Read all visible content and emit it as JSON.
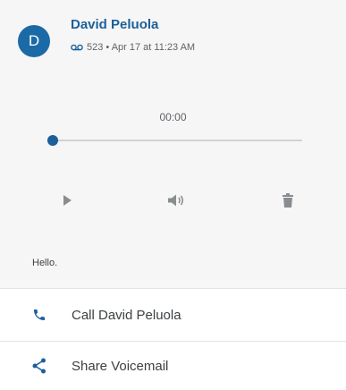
{
  "voicemail": {
    "avatar_letter": "D",
    "caller_name": "David Peluola",
    "meta": "523 • Apr 17 at 11:23 AM",
    "elapsed": "00:00",
    "progress": 0,
    "transcript": "Hello."
  },
  "controls": {
    "play_icon": "play-icon",
    "speaker_icon": "speaker-icon",
    "delete_icon": "trash-icon"
  },
  "actions": [
    {
      "label": "Call David Peluola",
      "icon": "phone-icon"
    },
    {
      "label": "Share Voicemail",
      "icon": "share-icon"
    }
  ],
  "colors": {
    "accent": "#1c5f9a",
    "avatar_bg": "#1c6aa5",
    "card_bg": "#f6f6f6"
  }
}
